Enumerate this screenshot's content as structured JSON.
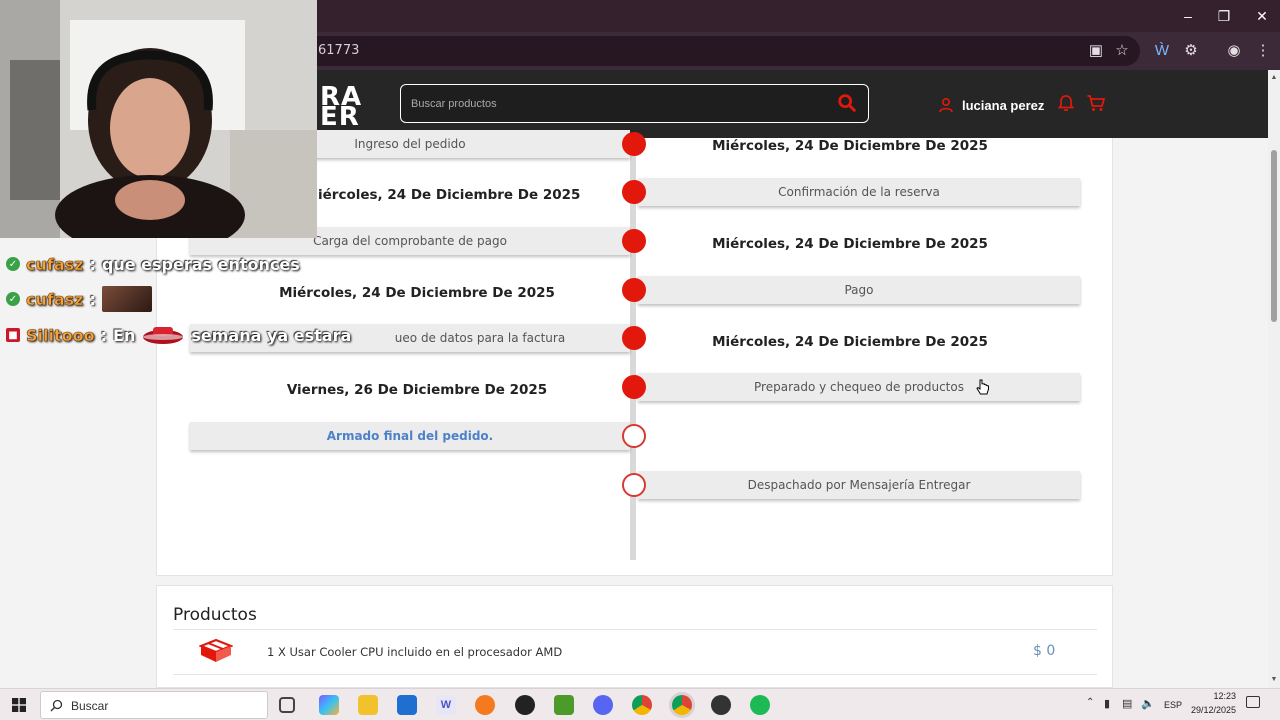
{
  "browser": {
    "url_fragment": "61773",
    "window_controls": [
      "minimize-icon",
      "restore-icon",
      "close-icon"
    ],
    "toolbar_icons": [
      "install-app-icon",
      "bookmark-star-icon",
      "extension-puzzle-icon",
      "translate-icon",
      "profile-icon",
      "menu-kebab-icon"
    ]
  },
  "header": {
    "logo_line1": "RA",
    "logo_line2": "ER",
    "search_placeholder": "Buscar productos",
    "user_name": "luciana perez",
    "accent_color": "#e2180c"
  },
  "timeline": {
    "steps": [
      {
        "label": "Ingreso del pedido",
        "side": "left",
        "status": "done",
        "date": "Miércoles, 24 De Diciembre De 2025"
      },
      {
        "label": "Confirmación de la reserva",
        "side": "right",
        "status": "done",
        "date": "Miércoles, 24 De Diciembre De 2025"
      },
      {
        "label": "Carga del comprobante de pago",
        "side": "left",
        "status": "done",
        "date": "Miércoles, 24 De Diciembre De 2025"
      },
      {
        "label": "Pago",
        "side": "right",
        "status": "done",
        "date": "Miércoles, 24 De Diciembre De 2025"
      },
      {
        "label": "Chequeo de datos para la factura",
        "side": "left",
        "status": "done",
        "date": "Miércoles, 24 De Diciembre De 2025"
      },
      {
        "label": "Preparado y chequeo de productos",
        "side": "right",
        "status": "done",
        "date": "Viernes, 26 De Diciembre De 2025"
      },
      {
        "label": "Armado final del pedido.",
        "side": "left",
        "status": "current",
        "date": ""
      },
      {
        "label": "Despachado por Mensajería Entregar",
        "side": "right",
        "status": "pending",
        "date": ""
      }
    ],
    "visible_left_labels": {
      "s0": "Ingreso del pedido",
      "s2": "Carga del comprobante de pago",
      "s4": "ueo de datos para la factura",
      "s6": "Armado final del pedido."
    },
    "visible_right_labels": {
      "s1": "Confirmación de la reserva",
      "s3": "Pago",
      "s5": "Preparado y chequeo de productos",
      "s7": "Despachado por Mensajería Entregar"
    },
    "visible_dates": {
      "d0": "Miércoles, 24 De Diciembre De 2025",
      "d1": "iércoles, 24 De Diciembre De 2025",
      "d2": "Miércoles, 24 De Diciembre De 2025",
      "d3": "Miércoles, 24 De Diciembre De 2025",
      "d4": "Miércoles, 24 De Diciembre De 2025",
      "d5": "Viernes, 26 De Diciembre De 2025"
    }
  },
  "products": {
    "title": "Productos",
    "items": [
      {
        "name": "1 X Usar Cooler CPU incluido en el procesador AMD",
        "price": "$ 0",
        "icon": "cooler-box-icon"
      }
    ]
  },
  "stream_overlay": {
    "chat": [
      {
        "user": "cufasz",
        "separator": ":",
        "message": "que esperas entonces"
      },
      {
        "user": "cufasz",
        "separator": ":",
        "message": ""
      },
      {
        "user": "Silitooo",
        "separator": ":",
        "message": "En",
        "message2": "semana ya estara"
      }
    ]
  },
  "taskbar": {
    "search_label": "Buscar",
    "language": "ESP",
    "time": "12:23",
    "date": "29/12/2025"
  }
}
